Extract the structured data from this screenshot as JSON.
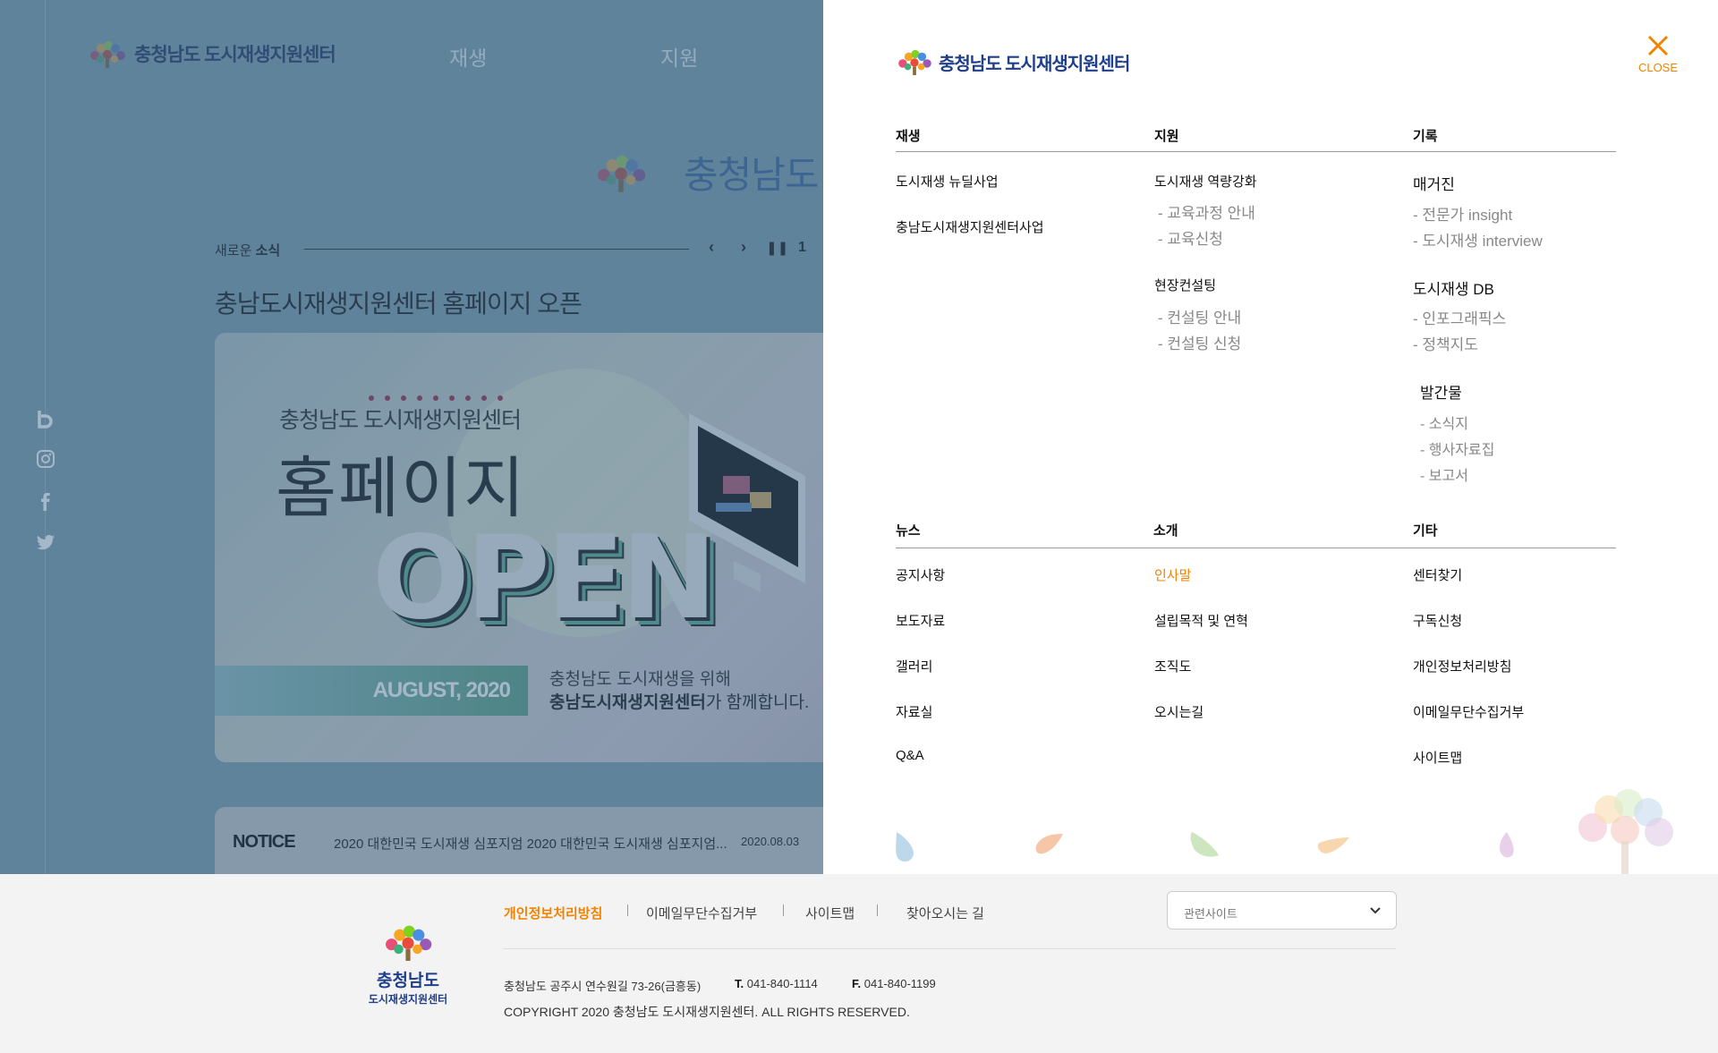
{
  "site": {
    "name": "충청남도 도시재생지원센터"
  },
  "colors": {
    "accent": "#f08300",
    "brand_blue": "#1f3f8a"
  },
  "background": {
    "nav": [
      "재생",
      "지원"
    ],
    "center_logo_text": "충청남도",
    "news": {
      "label_prefix": "새로운",
      "label_bold": "소식",
      "page": "1"
    },
    "headline": "충남도시재생지원센터 홈페이지 오픈",
    "banner": {
      "sub": "충청남도 도시재생지원센터",
      "big": "홈페이지",
      "open": "OPEN",
      "date": "AUGUST, 2020",
      "msg1": "충청남도 도시재생을 위해",
      "msg2_bold": "충남도시재생지원센터",
      "msg2_rest": "가 함께합니다."
    },
    "notice": {
      "label": "NOTICE",
      "text": "2020 대한민국 도시재생 심포지엄 2020 대한민국 도시재생 심포지엄...",
      "date": "2020.08.03"
    },
    "social_icons": [
      "blog-icon",
      "instagram-icon",
      "facebook-icon",
      "twitter-icon"
    ]
  },
  "panel": {
    "logo_text": "충청남도 도시재생지원센터",
    "close_label": "CLOSE",
    "section1": {
      "regen": {
        "title": "재생",
        "items": [
          "도시재생 뉴딜사업",
          "충남도시재생지원센터사업"
        ]
      },
      "support": {
        "title": "지원",
        "groups": [
          {
            "title": "도시재생 역량강화",
            "items": [
              "- 교육과정 안내",
              "- 교육신청"
            ]
          },
          {
            "title": "현장컨설팅",
            "items": [
              "- 컨설팅 안내",
              "- 컨설팅 신청"
            ]
          }
        ]
      },
      "records": {
        "title": "기록",
        "groups": [
          {
            "title": "매거진",
            "items": [
              "- 전문가 insight",
              "- 도시재생 interview"
            ]
          },
          {
            "title": "도시재생 DB",
            "items": [
              "- 인포그래픽스",
              "- 정책지도"
            ]
          },
          {
            "title": "발간물",
            "items": [
              "- 소식지",
              "- 행사자료집",
              "- 보고서"
            ]
          }
        ]
      }
    },
    "section2": {
      "news": {
        "title": "뉴스",
        "items": [
          "공지사항",
          "보도자료",
          "갤러리",
          "자료실",
          "Q&A"
        ]
      },
      "about": {
        "title": "소개",
        "items": [
          "인사말",
          "설립목적 및 연혁",
          "조직도",
          "오시는길"
        ]
      },
      "etc": {
        "title": "기타",
        "items": [
          "센터찾기",
          "구독신청",
          "개인정보처리방침",
          "이메일무단수집거부",
          "사이트맵"
        ]
      }
    }
  },
  "footer": {
    "logo_line1": "충청남도",
    "logo_line2": "도시재생지원센터",
    "links": [
      "개인정보처리방침",
      "이메일무단수집거부",
      "사이트맵",
      "찾아오시는 길"
    ],
    "select_placeholder": "관련사이트",
    "address": "충청남도 공주시 연수원길 73-26(금흥동)",
    "tel_label": "T.",
    "tel": "041-840-1114",
    "fax_label": "F.",
    "fax": "041-840-1199",
    "copyright": "COPYRIGHT 2020 충청남도 도시재생지원센터. ALL RIGHTS RESERVED."
  }
}
